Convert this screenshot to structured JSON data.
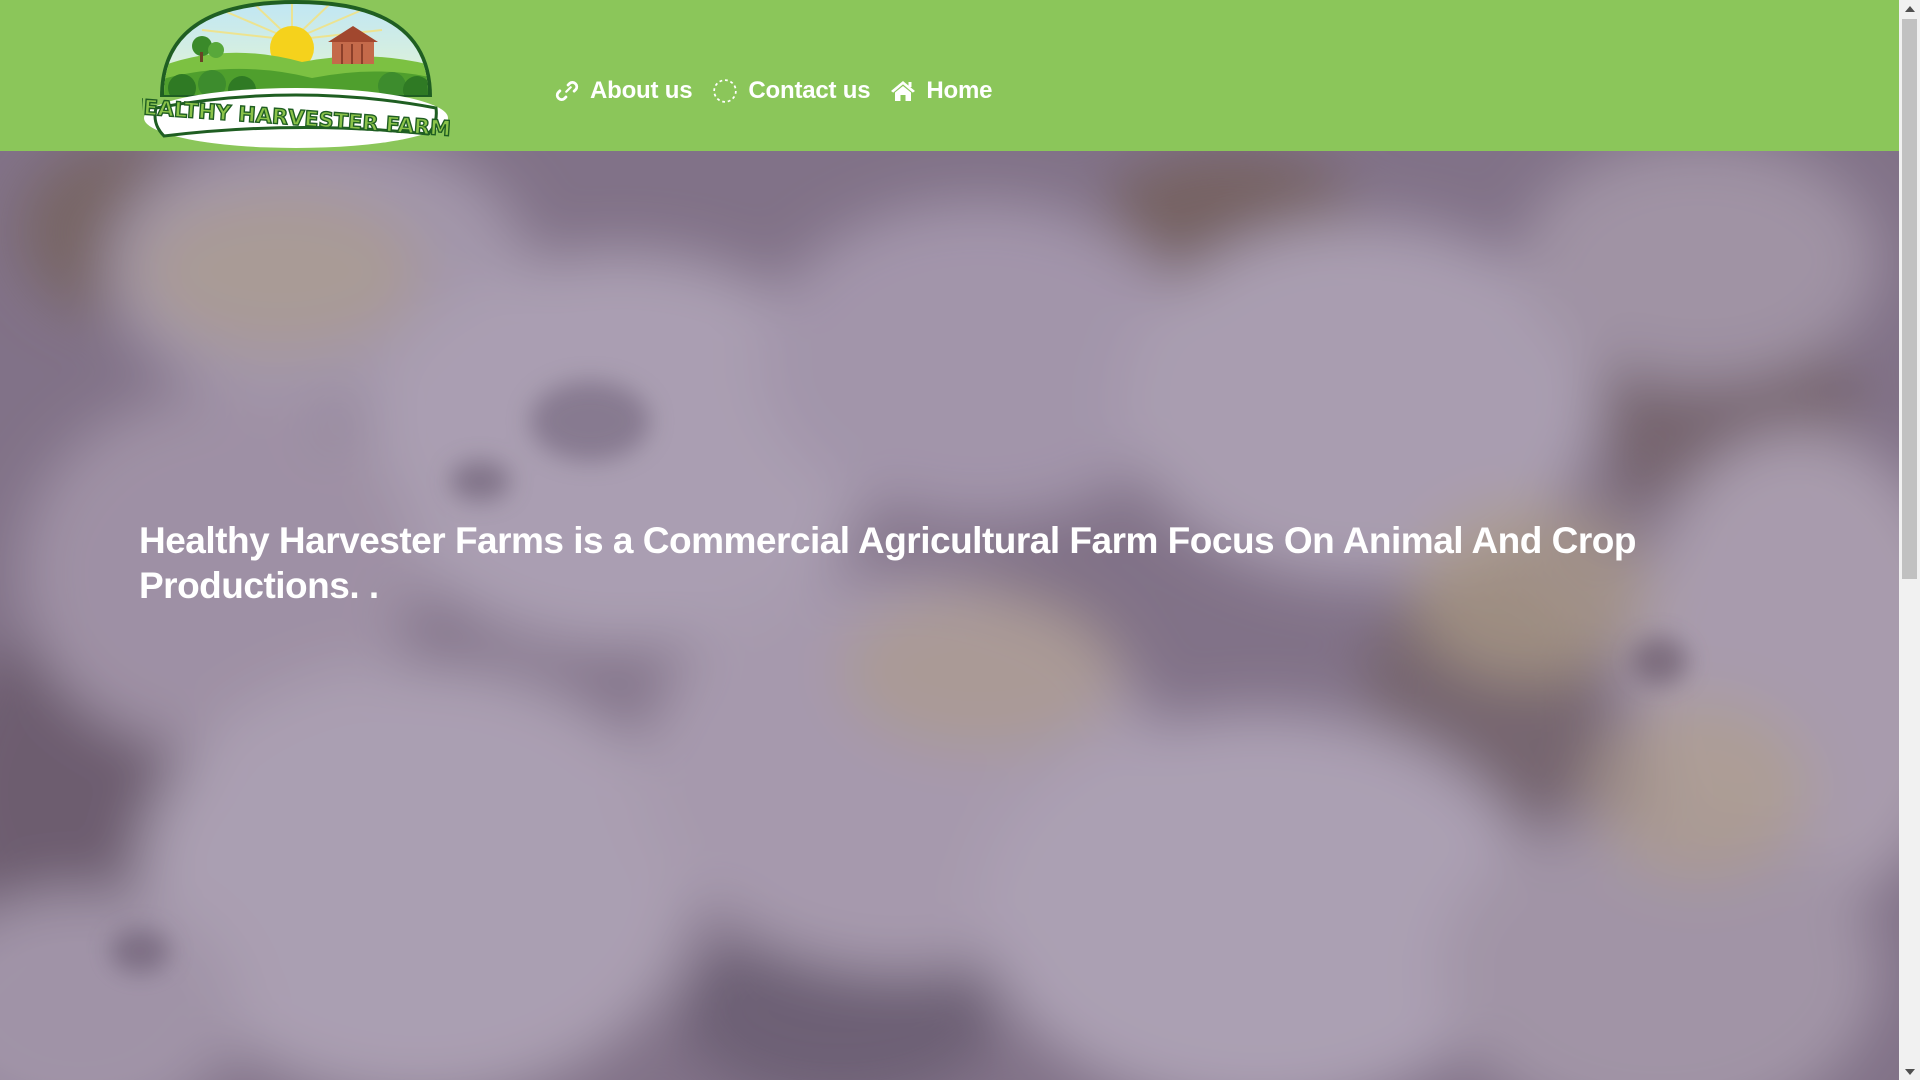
{
  "site": {
    "logo_text": "HEALTHY HARVESTER FARMS"
  },
  "nav": {
    "items": [
      {
        "label": "About us",
        "icon": "link-icon"
      },
      {
        "label": "Contact us",
        "icon": "loading-circle-icon"
      },
      {
        "label": "Home",
        "icon": "home-icon"
      }
    ]
  },
  "hero": {
    "headline": "Healthy Harvester Farms is a Commercial Agricultural Farm Focus On Animal And Crop Productions. .",
    "background": "blurred-baby-chicks-image"
  },
  "colors": {
    "header_bg": "#8bc65a",
    "nav_text": "#ffffff",
    "hero_overlay": "#7a6a86",
    "logo_green": "#2e7d32"
  }
}
